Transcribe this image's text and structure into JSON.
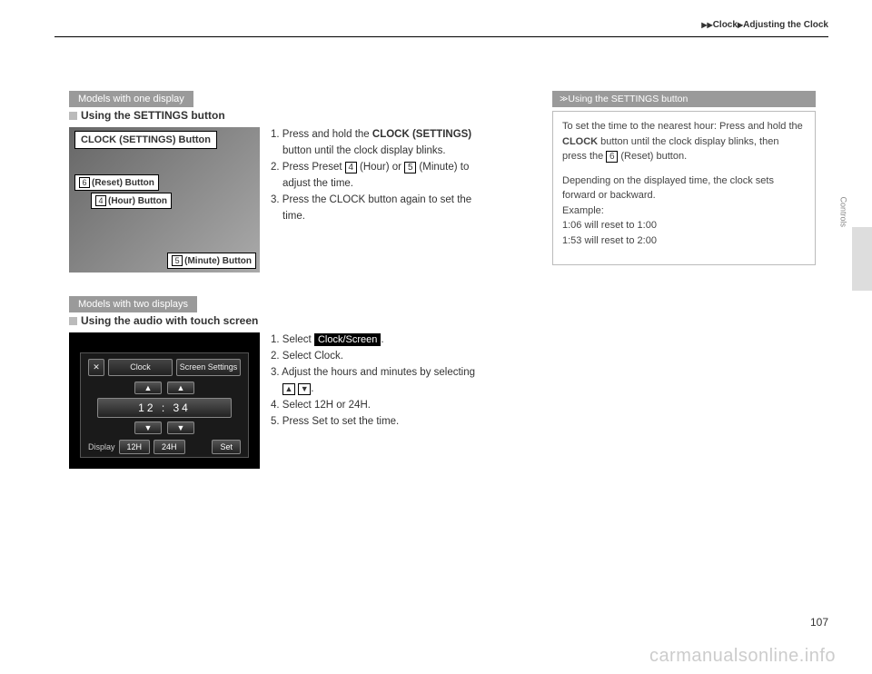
{
  "breadcrumb": {
    "a": "Clock",
    "b": "Adjusting the Clock"
  },
  "side_tab": "Controls",
  "page_number": "107",
  "watermark": "carmanualsonline.info",
  "sec1": {
    "badge": "Models with one display",
    "title": "Using the SETTINGS button",
    "labels": {
      "clock": "CLOCK (SETTINGS) Button",
      "reset_key": "6",
      "reset": "(Reset) Button",
      "hour_key": "4",
      "hour": "(Hour) Button",
      "minute_key": "5",
      "minute": "(Minute) Button"
    },
    "steps": {
      "s1a": "1. Press and hold the ",
      "s1b": "CLOCK (SETTINGS)",
      "s1c": "button until the clock display blinks.",
      "s2a": "2. Press Preset ",
      "s2k1": "4",
      "s2b": " (Hour) or ",
      "s2k2": "5",
      "s2c": " (Minute) to",
      "s2d": "adjust the time.",
      "s3a": "3. Press the CLOCK button again to set the",
      "s3b": "time."
    }
  },
  "sec2": {
    "badge": "Models with two displays",
    "title": "Using the audio with touch screen",
    "screen": {
      "clock_tab": "Clock",
      "settings_tab": "Screen Settings",
      "time": "12 : 34",
      "display": "Display",
      "h12": "12H",
      "h24": "24H",
      "set": "Set"
    },
    "steps": {
      "s1a": "1. Select ",
      "s1b": "Clock/Screen",
      "s1c": ".",
      "s2": "2. Select Clock.",
      "s3a": "3. Adjust the hours and minutes by selecting",
      "s3b": ".",
      "s4": "4. Select 12H or 24H.",
      "s5": "5. Press Set to set the time."
    }
  },
  "side": {
    "head": "Using the SETTINGS button",
    "p1a": "To set the time to the nearest hour: Press and hold the ",
    "p1b": "CLOCK",
    "p1c": " button until the clock display blinks, then press the ",
    "p1key": "6",
    "p1d": " (Reset) button.",
    "p2": "Depending on the displayed time, the clock sets forward or backward.",
    "p3": "Example:",
    "p4": "1:06 will reset to 1:00",
    "p5": "1:53 will reset to 2:00"
  }
}
